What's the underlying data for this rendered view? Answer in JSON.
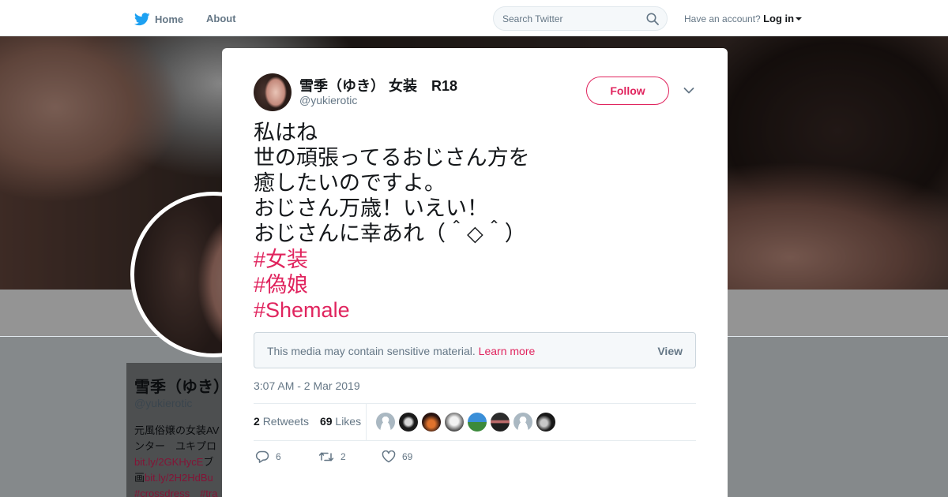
{
  "nav": {
    "home_label": "Home",
    "about_label": "About",
    "search_placeholder": "Search Twitter",
    "account_prompt": "Have an account?",
    "login_label": "Log in",
    "brand_color": "#1da1f2"
  },
  "profile_background": {
    "name": "雪季（ゆき）",
    "handle": "@yukierotic",
    "bio_line1": "元風俗嬢の女装AV",
    "bio_line2": "ンター　ユキプロ",
    "link1": "bit.ly/2GKHycE",
    "link1_suffix": "ブ",
    "link2_prefix": "画",
    "link2": "bit.ly/2H2HdBu",
    "tags": "#crossdress　#tra"
  },
  "tweet": {
    "author_name": "雪季（ゆき） 女装　R18",
    "author_handle": "@yukierotic",
    "follow_label": "Follow",
    "text_lines": [
      "私はね",
      "世の頑張ってるおじさん方を",
      "癒したいのですよ。",
      "おじさん万歳！いえい！",
      "おじさんに幸あれ（＾◇＾）"
    ],
    "hashtags": [
      "#女装",
      "#偽娘",
      "#Shemale"
    ],
    "sensitive_message": "This media may contain sensitive material.",
    "learn_more_label": "Learn more",
    "view_label": "View",
    "timestamp": "3:07 AM - 2 Mar 2019",
    "retweets_count": "2",
    "retweets_label": "Retweets",
    "likes_count": "69",
    "likes_label": "Likes",
    "reply_count": "6",
    "retweet_action_count": "2",
    "like_action_count": "69",
    "accent_color": "#e0245e"
  }
}
